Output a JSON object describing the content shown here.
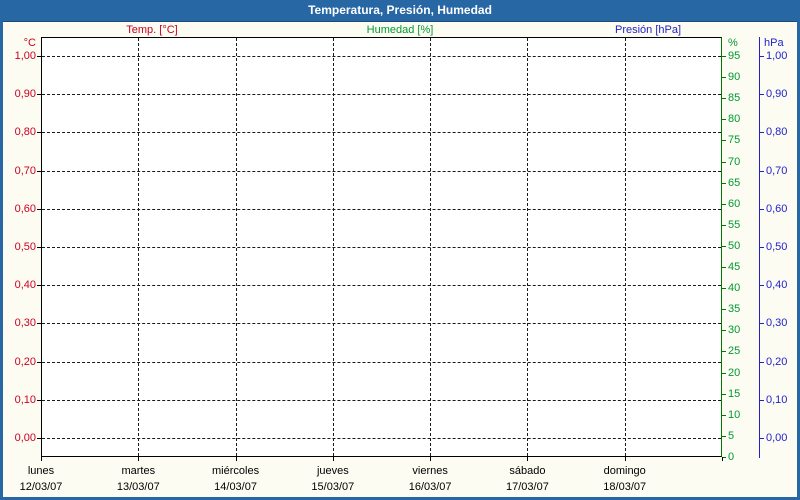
{
  "window": {
    "title": "Temperatura, Presión, Humedad"
  },
  "legend": {
    "items": [
      {
        "label": "Temp. [°C]",
        "color": "#cc0022"
      },
      {
        "label": "Humedad [%]",
        "color": "#009933"
      },
      {
        "label": "Presión [hPa]",
        "color": "#2222cc"
      }
    ]
  },
  "chart_data": {
    "type": "line",
    "title": "Temperatura, Presión, Humedad",
    "grid": true,
    "legend_position": "top",
    "plot_note": "empty plot area – no data traces drawn for the week",
    "x_axis": {
      "days": [
        {
          "weekday": "lunes",
          "date": "12/03/07"
        },
        {
          "weekday": "martes",
          "date": "13/03/07"
        },
        {
          "weekday": "miércoles",
          "date": "14/03/07"
        },
        {
          "weekday": "jueves",
          "date": "15/03/07"
        },
        {
          "weekday": "viernes",
          "date": "16/03/07"
        },
        {
          "weekday": "sábado",
          "date": "17/03/07"
        },
        {
          "weekday": "domingo",
          "date": "18/03/07"
        }
      ]
    },
    "axes": {
      "temperature": {
        "unit": "°C",
        "side": "left",
        "color": "#cc0022",
        "range": [
          0,
          1
        ],
        "ticks": [
          "1,00",
          "0,90",
          "0,80",
          "0,70",
          "0,60",
          "0,50",
          "0,40",
          "0,30",
          "0,20",
          "0,10",
          "0,00"
        ]
      },
      "humidity": {
        "unit": "%",
        "side": "right-inner",
        "color": "#009933",
        "axis_line_color": "#007700",
        "range": [
          0,
          100
        ],
        "ticks": [
          "95",
          "90",
          "85",
          "80",
          "75",
          "70",
          "65",
          "60",
          "55",
          "50",
          "45",
          "40",
          "35",
          "30",
          "25",
          "20",
          "15",
          "10",
          "5",
          "0"
        ]
      },
      "pressure": {
        "unit": "hPa",
        "side": "right-outer",
        "color": "#2222cc",
        "range": [
          0,
          1
        ],
        "ticks": [
          "1,00",
          "0,90",
          "0,80",
          "0,70",
          "0,60",
          "0,50",
          "0,40",
          "0,30",
          "0,20",
          "0,10",
          "0,00"
        ]
      }
    },
    "series": [
      {
        "name": "Temp. [°C]",
        "unit": "°C",
        "values": []
      },
      {
        "name": "Humedad [%]",
        "unit": "%",
        "values": []
      },
      {
        "name": "Presión [hPa]",
        "unit": "hPa",
        "values": []
      }
    ]
  }
}
